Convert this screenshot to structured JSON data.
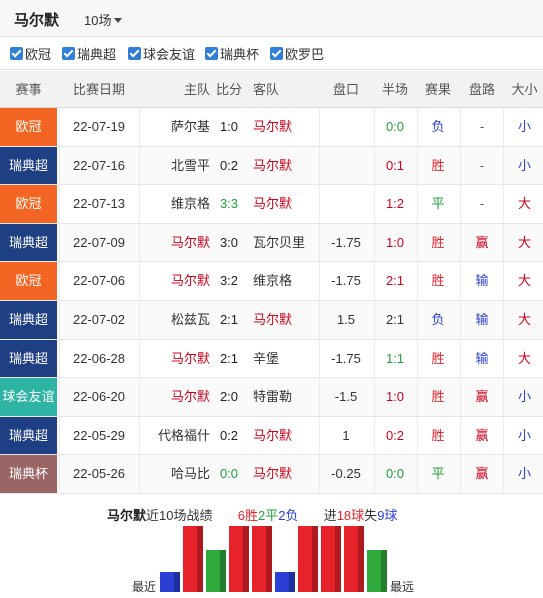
{
  "header": {
    "team": "马尔默",
    "count": "10场"
  },
  "filters": [
    {
      "label": "欧冠",
      "checked": true
    },
    {
      "label": "瑞典超",
      "checked": true
    },
    {
      "label": "球会友谊",
      "checked": true
    },
    {
      "label": "瑞典杯",
      "checked": true
    },
    {
      "label": "欧罗巴",
      "checked": true
    }
  ],
  "columns": [
    "赛事",
    "比赛日期",
    "主队",
    "比分",
    "客队",
    "盘口",
    "半场",
    "赛果",
    "盘路",
    "大小"
  ],
  "colors": {
    "欧冠": "#f26522",
    "瑞典超": "#1e3f84",
    "球会友谊": "#2db4a4",
    "瑞典杯": "#9a6464",
    "team_red": "#d0021b",
    "win": "#e8222a",
    "draw": "#1fa23a",
    "lose": "#2b3fd6"
  },
  "matches": [
    {
      "comp": "欧冠",
      "date": "22-07-19",
      "home": "萨尔基",
      "score": "1:0",
      "away": "马尔默",
      "pan": "",
      "half": "0:0",
      "result": "负",
      "lu": "-",
      "size": "小"
    },
    {
      "comp": "瑞典超",
      "date": "22-07-16",
      "home": "北雪平",
      "score": "0:2",
      "away": "马尔默",
      "pan": "",
      "half": "0:1",
      "result": "胜",
      "lu": "-",
      "size": "小"
    },
    {
      "comp": "欧冠",
      "date": "22-07-13",
      "home": "维京格",
      "score": "3:3",
      "away": "马尔默",
      "pan": "",
      "half": "1:2",
      "result": "平",
      "lu": "-",
      "size": "大"
    },
    {
      "comp": "瑞典超",
      "date": "22-07-09",
      "home": "马尔默",
      "score": "3:0",
      "away": "瓦尔贝里",
      "pan": "-1.75",
      "half": "1:0",
      "result": "胜",
      "lu": "赢",
      "size": "大"
    },
    {
      "comp": "欧冠",
      "date": "22-07-06",
      "home": "马尔默",
      "score": "3:2",
      "away": "维京格",
      "pan": "-1.75",
      "half": "2:1",
      "result": "胜",
      "lu": "输",
      "size": "大"
    },
    {
      "comp": "瑞典超",
      "date": "22-07-02",
      "home": "松兹瓦",
      "score": "2:1",
      "away": "马尔默",
      "pan": "1.5",
      "half": "2:1",
      "result": "负",
      "lu": "输",
      "size": "大"
    },
    {
      "comp": "瑞典超",
      "date": "22-06-28",
      "home": "马尔默",
      "score": "2:1",
      "away": "辛堡",
      "pan": "-1.75",
      "half": "1:1",
      "result": "胜",
      "lu": "输",
      "size": "大"
    },
    {
      "comp": "球会友谊",
      "date": "22-06-20",
      "home": "马尔默",
      "score": "2:0",
      "away": "特雷勒",
      "pan": "-1.5",
      "half": "1:0",
      "result": "胜",
      "lu": "赢",
      "size": "小"
    },
    {
      "comp": "瑞典超",
      "date": "22-05-29",
      "home": "代格福什",
      "score": "0:2",
      "away": "马尔默",
      "pan": "1",
      "half": "0:2",
      "result": "胜",
      "lu": "赢",
      "size": "小"
    },
    {
      "comp": "瑞典杯",
      "date": "22-05-26",
      "home": "哈马比",
      "score": "0:0",
      "away": "马尔默",
      "pan": "-0.25",
      "half": "0:0",
      "result": "平",
      "lu": "赢",
      "size": "小"
    }
  ],
  "summary": {
    "team": "马尔默",
    "text_recent": "近10场战绩",
    "wins": "6胜",
    "draws": "2平",
    "losses": "2负",
    "goals_for_prefix": "进",
    "goals_for": "18球",
    "goals_against_prefix": "失",
    "goals_against": "9球"
  },
  "chart_labels": {
    "recent": "最近",
    "far": "最远"
  },
  "chart_data": {
    "type": "bar",
    "categories": [
      "22-07-19",
      "22-07-16",
      "22-07-13",
      "22-07-09",
      "22-07-06",
      "22-07-02",
      "22-06-28",
      "22-06-20",
      "22-05-29",
      "22-05-26"
    ],
    "values": [
      "负",
      "胜",
      "平",
      "胜",
      "胜",
      "负",
      "胜",
      "胜",
      "胜",
      "平"
    ],
    "level": {
      "胜": 3,
      "平": 2,
      "负": 1
    },
    "ylim": [
      0,
      3
    ]
  }
}
